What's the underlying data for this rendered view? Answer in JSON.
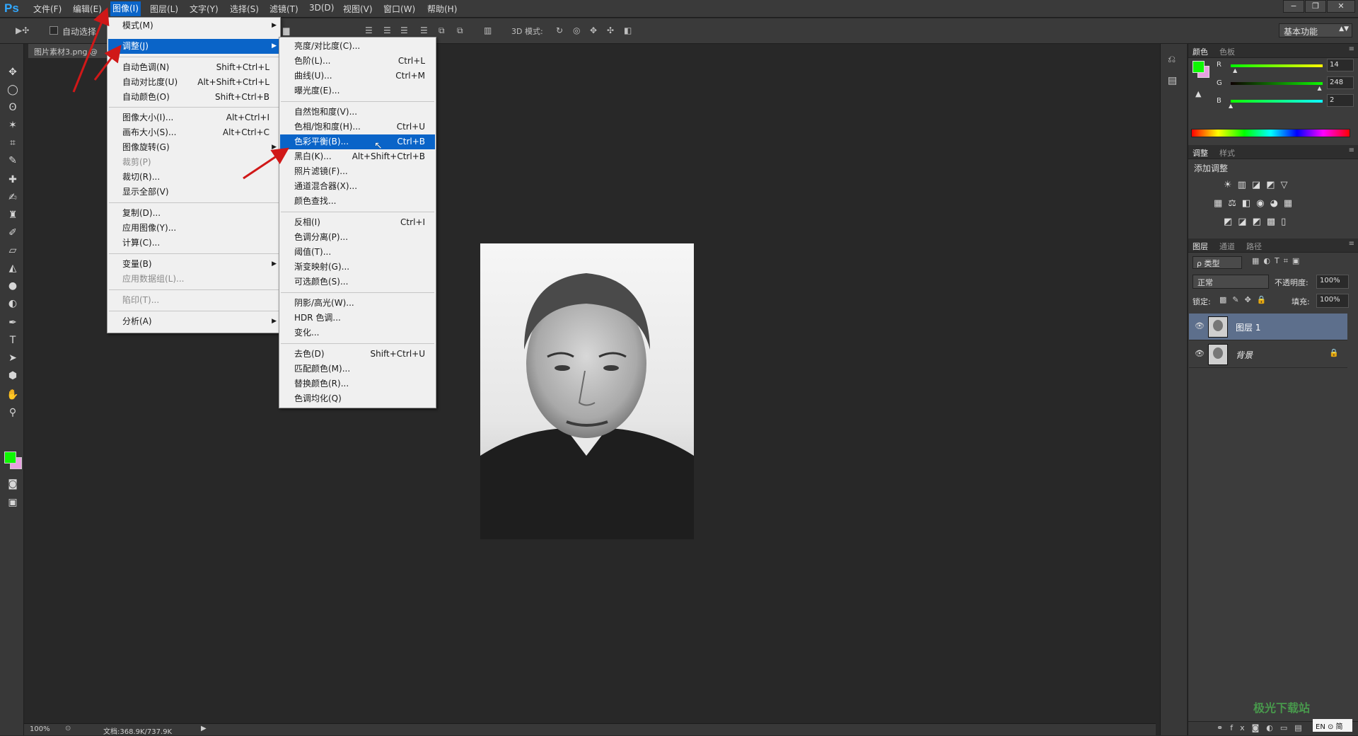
{
  "app": {
    "logo": "Ps"
  },
  "menubar": {
    "items": [
      "文件(F)",
      "编辑(E)",
      "图像(I)",
      "图层(L)",
      "文字(Y)",
      "选择(S)",
      "滤镜(T)",
      "3D(D)",
      "视图(V)",
      "窗口(W)",
      "帮助(H)"
    ],
    "active": "图像(I)"
  },
  "window_controls": {
    "minimize": "−",
    "restore": "❐",
    "close": "✕"
  },
  "options_bar": {
    "auto_select_label": "自动选择",
    "mode3d_label": "3D 模式:",
    "workspace": "基本功能"
  },
  "document": {
    "tab_title": "图片素材3.png @",
    "zoom": "100%",
    "doc_info": "文档:368.9K/737.9K"
  },
  "image_menu": {
    "items": [
      {
        "label": "模式(M)",
        "shortcut": "",
        "submenu": true
      },
      {
        "label": "调整(J)",
        "shortcut": "",
        "submenu": true,
        "highlighted": true
      },
      {
        "label": "自动色调(N)",
        "shortcut": "Shift+Ctrl+L"
      },
      {
        "label": "自动对比度(U)",
        "shortcut": "Alt+Shift+Ctrl+L"
      },
      {
        "label": "自动颜色(O)",
        "shortcut": "Shift+Ctrl+B"
      },
      {
        "label": "图像大小(I)...",
        "shortcut": "Alt+Ctrl+I"
      },
      {
        "label": "画布大小(S)...",
        "shortcut": "Alt+Ctrl+C"
      },
      {
        "label": "图像旋转(G)",
        "shortcut": "",
        "submenu": true
      },
      {
        "label": "裁剪(P)",
        "shortcut": "",
        "disabled": true
      },
      {
        "label": "裁切(R)...",
        "shortcut": ""
      },
      {
        "label": "显示全部(V)",
        "shortcut": ""
      },
      {
        "label": "复制(D)...",
        "shortcut": ""
      },
      {
        "label": "应用图像(Y)...",
        "shortcut": ""
      },
      {
        "label": "计算(C)...",
        "shortcut": ""
      },
      {
        "label": "变量(B)",
        "shortcut": "",
        "submenu": true
      },
      {
        "label": "应用数据组(L)...",
        "shortcut": "",
        "disabled": true
      },
      {
        "label": "陷印(T)...",
        "shortcut": "",
        "disabled": true
      },
      {
        "label": "分析(A)",
        "shortcut": "",
        "submenu": true
      }
    ]
  },
  "adjust_menu": {
    "items": [
      {
        "label": "亮度/对比度(C)...",
        "shortcut": ""
      },
      {
        "label": "色阶(L)...",
        "shortcut": "Ctrl+L"
      },
      {
        "label": "曲线(U)...",
        "shortcut": "Ctrl+M"
      },
      {
        "label": "曝光度(E)...",
        "shortcut": ""
      },
      {
        "label": "自然饱和度(V)...",
        "shortcut": ""
      },
      {
        "label": "色相/饱和度(H)...",
        "shortcut": "Ctrl+U"
      },
      {
        "label": "色彩平衡(B)...",
        "shortcut": "Ctrl+B",
        "highlighted": true
      },
      {
        "label": "黑白(K)...",
        "shortcut": "Alt+Shift+Ctrl+B"
      },
      {
        "label": "照片滤镜(F)...",
        "shortcut": ""
      },
      {
        "label": "通道混合器(X)...",
        "shortcut": ""
      },
      {
        "label": "颜色查找...",
        "shortcut": ""
      },
      {
        "label": "反相(I)",
        "shortcut": "Ctrl+I"
      },
      {
        "label": "色调分离(P)...",
        "shortcut": ""
      },
      {
        "label": "阈值(T)...",
        "shortcut": ""
      },
      {
        "label": "渐变映射(G)...",
        "shortcut": ""
      },
      {
        "label": "可选颜色(S)...",
        "shortcut": ""
      },
      {
        "label": "阴影/高光(W)...",
        "shortcut": ""
      },
      {
        "label": "HDR 色调...",
        "shortcut": ""
      },
      {
        "label": "变化...",
        "shortcut": ""
      },
      {
        "label": "去色(D)",
        "shortcut": "Shift+Ctrl+U"
      },
      {
        "label": "匹配颜色(M)...",
        "shortcut": ""
      },
      {
        "label": "替换颜色(R)...",
        "shortcut": ""
      },
      {
        "label": "色调均化(Q)",
        "shortcut": ""
      }
    ]
  },
  "color_panel": {
    "tabs": [
      "颜色",
      "色板"
    ],
    "channels": [
      {
        "name": "R",
        "value": "14",
        "fraction": 0.055
      },
      {
        "name": "G",
        "value": "248",
        "fraction": 0.973
      },
      {
        "name": "B",
        "value": "2",
        "fraction": 0.008
      }
    ],
    "foreground": "#0ef802",
    "background": "#e8a0e0"
  },
  "adjust_panel": {
    "tabs": [
      "调整",
      "样式"
    ],
    "add_label": "添加调整"
  },
  "layers_panel": {
    "tabs": [
      "图层",
      "通道",
      "路径"
    ],
    "filter_label": "ρ 类型",
    "blend_mode": "正常",
    "opacity_label": "不透明度:",
    "opacity": "100%",
    "lock_label": "锁定:",
    "fill_label": "填充:",
    "fill": "100%",
    "layers": [
      {
        "name": "图层 1",
        "selected": true,
        "locked": false
      },
      {
        "name": "背景",
        "selected": false,
        "locked": true
      }
    ]
  },
  "watermark": {
    "text": "极光下载站",
    "ime": "EN ⊙ 简"
  },
  "colors": {
    "menu_highlight": "#0a64c8",
    "accent_fg": "#0ef802",
    "arrow": "#d01818"
  }
}
